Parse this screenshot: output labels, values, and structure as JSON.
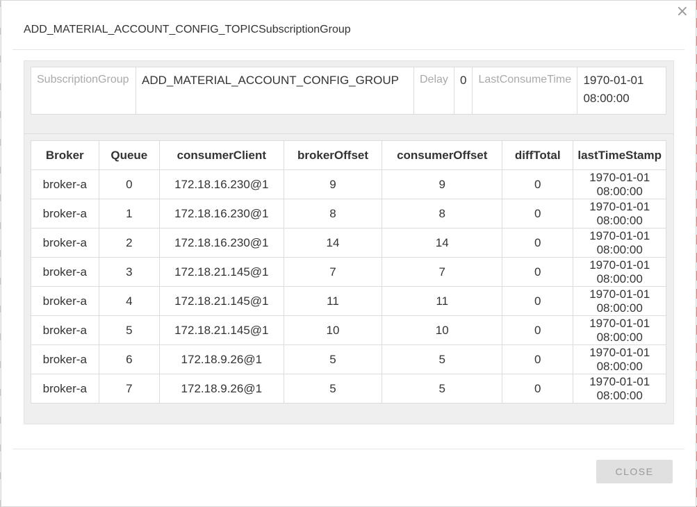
{
  "dialog": {
    "title": "ADD_MATERIAL_ACCOUNT_CONFIG_TOPICSubscriptionGroup",
    "close_icon": "×",
    "close_button": "CLOSE"
  },
  "summary": {
    "group_label": "SubscriptionGroup",
    "group_value": "ADD_MATERIAL_ACCOUNT_CONFIG_GROUP",
    "delay_label": "Delay",
    "delay_value": "0",
    "last_consume_label": "LastConsumeTime",
    "last_consume_value": "1970-01-01 08:00:00"
  },
  "table": {
    "headers": [
      "Broker",
      "Queue",
      "consumerClient",
      "brokerOffset",
      "consumerOffset",
      "diffTotal",
      "lastTimeStamp"
    ],
    "rows": [
      [
        "broker-a",
        "0",
        "172.18.16.230@1",
        "9",
        "9",
        "0",
        "1970-01-01 08:00:00"
      ],
      [
        "broker-a",
        "1",
        "172.18.16.230@1",
        "8",
        "8",
        "0",
        "1970-01-01 08:00:00"
      ],
      [
        "broker-a",
        "2",
        "172.18.16.230@1",
        "14",
        "14",
        "0",
        "1970-01-01 08:00:00"
      ],
      [
        "broker-a",
        "3",
        "172.18.21.145@1",
        "7",
        "7",
        "0",
        "1970-01-01 08:00:00"
      ],
      [
        "broker-a",
        "4",
        "172.18.21.145@1",
        "11",
        "11",
        "0",
        "1970-01-01 08:00:00"
      ],
      [
        "broker-a",
        "5",
        "172.18.21.145@1",
        "10",
        "10",
        "0",
        "1970-01-01 08:00:00"
      ],
      [
        "broker-a",
        "6",
        "172.18.9.26@1",
        "5",
        "5",
        "0",
        "1970-01-01 08:00:00"
      ],
      [
        "broker-a",
        "7",
        "172.18.9.26@1",
        "5",
        "5",
        "0",
        "1970-01-01 08:00:00"
      ]
    ]
  }
}
